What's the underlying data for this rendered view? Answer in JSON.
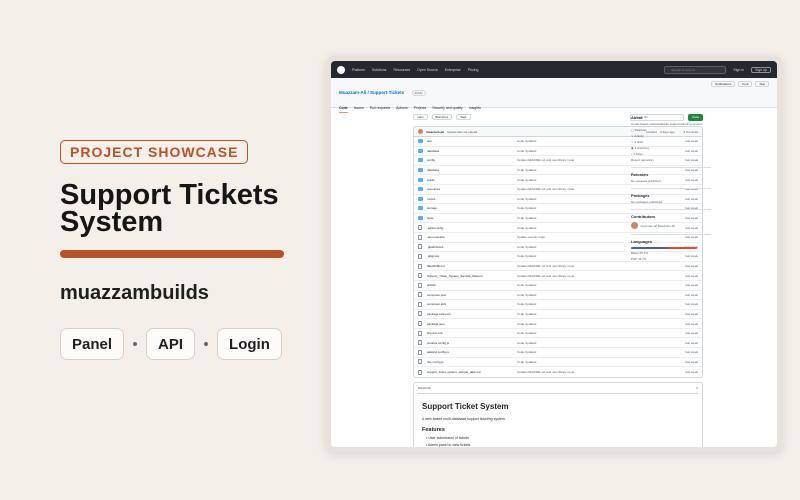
{
  "showcase": {
    "badge": "PROJECT SHOWCASE",
    "title": "Support Tickets System",
    "author": "muazzambuilds",
    "chips": [
      "Panel",
      "API",
      "Login"
    ]
  },
  "github": {
    "nav": [
      "Platform",
      "Solutions",
      "Resources",
      "Open Source",
      "Enterprise",
      "Pricing"
    ],
    "search_placeholder": "Search or jump to...",
    "sign_in": "Sign in",
    "sign_up": "Sign up",
    "repo_title": "Muazzam-Ali / Support-Tickets",
    "visibility": "Public",
    "repo_actions": [
      "Notifications",
      "Fork",
      "Star"
    ],
    "tabs": [
      "Code",
      "Issues",
      "Pull requests",
      "Actions",
      "Projects",
      "Security and quality",
      "Insights"
    ],
    "branch": "main",
    "branches": "Branches",
    "tags": "Tags",
    "go_to_file": "Go to file",
    "code_button": "Code",
    "commit": {
      "who": "muazzam-ali",
      "message": "Update files via upload",
      "meta": "ecc0a1c · 3 days ago",
      "count": "5 Commits"
    },
    "files": [
      {
        "name": "app",
        "type": "dir",
        "msg": "Code Updated",
        "time": "last week"
      },
      {
        "name": "database",
        "type": "dir",
        "msg": "Code Updated",
        "time": "last week"
      },
      {
        "name": "config",
        "type": "dir",
        "msg": "Update README.md and new library route",
        "time": "last week"
      },
      {
        "name": "database",
        "type": "dir",
        "msg": "Code Updated",
        "time": "last week"
      },
      {
        "name": "public",
        "type": "dir",
        "msg": "Code Updated",
        "time": "last week"
      },
      {
        "name": "resources",
        "type": "dir",
        "msg": "Update README.md and new library route",
        "time": "last week"
      },
      {
        "name": "routes",
        "type": "dir",
        "msg": "Code Updated",
        "time": "last week"
      },
      {
        "name": "storage",
        "type": "dir",
        "msg": "Code Updated",
        "time": "last week"
      },
      {
        "name": "tests",
        "type": "dir",
        "msg": "Code Updated",
        "time": "last week"
      },
      {
        "name": ".editorconfig",
        "type": "file",
        "msg": "Code Updated",
        "time": "last week"
      },
      {
        "name": ".env.example",
        "type": "file",
        "msg": "Update security login",
        "time": "last week"
      },
      {
        "name": ".gitattributes",
        "type": "file",
        "msg": "Code Updated",
        "time": "last week"
      },
      {
        "name": ".gitignore",
        "type": "file",
        "msg": "Code Updated",
        "time": "last week"
      },
      {
        "name": "README.md",
        "type": "file",
        "msg": "Update README.md and new library route",
        "time": "last week"
      },
      {
        "name": "Support_Ticket_System_Sample_Data.txt",
        "type": "file",
        "msg": "Update README.md and new library route",
        "time": "last week"
      },
      {
        "name": "artisan",
        "type": "file",
        "msg": "Code Updated",
        "time": "last week"
      },
      {
        "name": "composer.json",
        "type": "file",
        "msg": "Code Updated",
        "time": "last week"
      },
      {
        "name": "composer.lock",
        "type": "file",
        "msg": "Code Updated",
        "time": "last week"
      },
      {
        "name": "package-lock.json",
        "type": "file",
        "msg": "Code Updated",
        "time": "last week"
      },
      {
        "name": "package.json",
        "type": "file",
        "msg": "Code Updated",
        "time": "last week"
      },
      {
        "name": "phpunit.xml",
        "type": "file",
        "msg": "Code Updated",
        "time": "last week"
      },
      {
        "name": "postcss.config.js",
        "type": "file",
        "msg": "Code Updated",
        "time": "last week"
      },
      {
        "name": "tailwind.config.js",
        "type": "file",
        "msg": "Code Updated",
        "time": "last week"
      },
      {
        "name": "vite.config.js",
        "type": "file",
        "msg": "Code Updated",
        "time": "last week"
      },
      {
        "name": "support_ticket_system_sample_data.sql",
        "type": "file",
        "msg": "Update README.md and new library route",
        "time": "last week"
      }
    ],
    "readme": {
      "label": "README",
      "title": "Support Ticket System",
      "desc": "A web-based multi-database support ticketing system.",
      "features_heading": "Features",
      "features": [
        "User submission of tickets",
        "Admin panel to view tickets"
      ]
    },
    "about": {
      "heading": "About",
      "desc": "A web-based multi-database support ticketing system.",
      "links": [
        "Readme",
        "Activity",
        "0 stars",
        "1 watching",
        "0 forks"
      ],
      "report": "Report repository"
    },
    "releases": {
      "heading": "Releases",
      "text": "No releases published"
    },
    "packages": {
      "heading": "Packages",
      "text": "No packages published"
    },
    "contributors": {
      "heading": "Contributors",
      "name": "muazzam-ali Muazzam Ali"
    },
    "languages": {
      "heading": "Languages",
      "items": [
        "Blade 55.3%",
        "PHP 44.7%"
      ]
    },
    "colors": {
      "header": "#24292f",
      "link": "#0969da",
      "green": "#1f883d"
    }
  }
}
